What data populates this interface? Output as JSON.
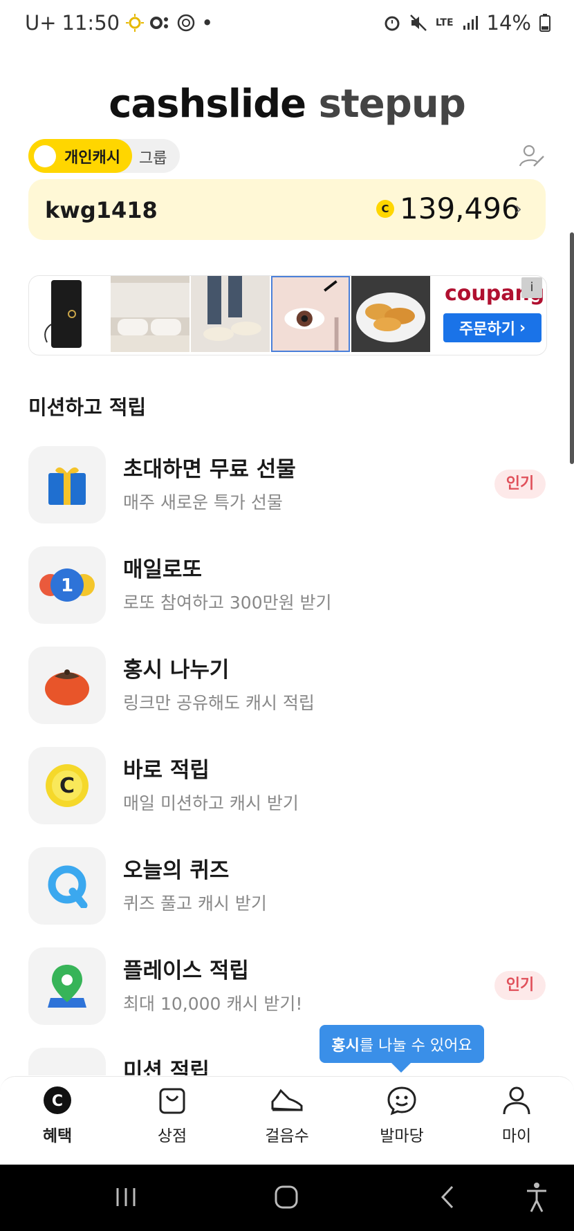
{
  "status_bar": {
    "carrier": "U+",
    "time": "11:50",
    "dot": "•",
    "network": "LTE",
    "battery": "14%"
  },
  "header": {
    "brand_part1": "cashslide",
    "brand_part2": "stepup"
  },
  "account_toggle": {
    "active": "개인캐시",
    "inactive": "그룹"
  },
  "balance": {
    "username": "kwg1418",
    "coin_symbol": "C",
    "amount": "139,496",
    "chevron": "›"
  },
  "ad_banner": {
    "brand": "coupang",
    "button_label": "주문하기",
    "button_chevron": "›",
    "info": "i"
  },
  "section": {
    "title": "미션하고 적립"
  },
  "missions": [
    {
      "title": "초대하면 무료 선물",
      "subtitle": "매주 새로운 특가 선물",
      "badge": "인기",
      "icon": "gift-icon"
    },
    {
      "title": "매일로또",
      "subtitle": "로또 참여하고 300만원 받기",
      "badge": "",
      "icon": "lotto-ball-icon",
      "icon_text": "1"
    },
    {
      "title": "홍시 나누기",
      "subtitle": "링크만 공유해도 캐시 적립",
      "badge": "",
      "icon": "persimmon-icon"
    },
    {
      "title": "바로 적립",
      "subtitle": "매일 미션하고 캐시 받기",
      "badge": "",
      "icon": "cash-coin-icon",
      "icon_text": "C"
    },
    {
      "title": "오늘의 퀴즈",
      "subtitle": "퀴즈 풀고 캐시 받기",
      "badge": "",
      "icon": "quiz-icon"
    },
    {
      "title": "플레이스 적립",
      "subtitle": "최대 10,000 캐시 받기!",
      "badge": "인기",
      "icon": "map-pin-icon"
    },
    {
      "title": "미션 적립",
      "subtitle": "",
      "badge": "",
      "icon": "mission-icon"
    }
  ],
  "tooltip": {
    "bold": "홍시",
    "rest": "를 나눌 수 있어요"
  },
  "bottom_nav": [
    {
      "label": "혜택",
      "icon": "benefit-coin-icon",
      "active": true
    },
    {
      "label": "상점",
      "icon": "shop-bag-icon",
      "active": false
    },
    {
      "label": "걸음수",
      "icon": "shoe-icon",
      "active": false
    },
    {
      "label": "발마당",
      "icon": "smile-chat-icon",
      "active": false
    },
    {
      "label": "마이",
      "icon": "person-icon",
      "active": false
    }
  ],
  "colors": {
    "accent_yellow": "#ffd600",
    "balance_bg": "#fff8d6",
    "badge_red": "#e0505a",
    "tooltip_blue": "#3a8fe8"
  }
}
